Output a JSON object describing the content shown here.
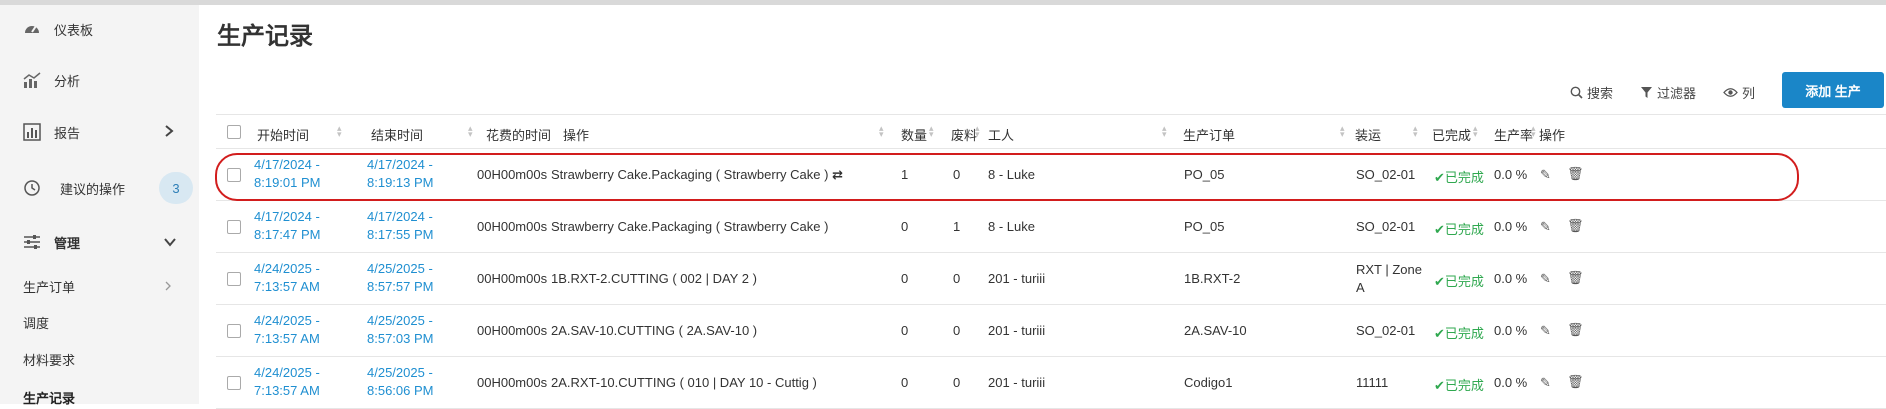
{
  "sidebar": {
    "items": [
      {
        "label": "仪表板",
        "icon": "dashboard-icon"
      },
      {
        "label": "分析",
        "icon": "analytics-icon"
      },
      {
        "label": "报告",
        "icon": "report-icon"
      },
      {
        "label": "建议的操作",
        "icon": "history-icon",
        "badge": "3"
      },
      {
        "label": "管理",
        "icon": "sliders-icon"
      }
    ],
    "sub_items": [
      "生产订单",
      "调度",
      "材料要求",
      "生产记录"
    ]
  },
  "page": {
    "title": "生产记录"
  },
  "toolbar": {
    "search": "搜索",
    "filter": "过滤器",
    "columns": "列",
    "add": "添加 生产"
  },
  "table": {
    "headers": [
      "开始时间",
      "结束时间",
      "花费的时间",
      "操作",
      "数量",
      "废料",
      "工人",
      "生产订单",
      "装运",
      "已完成",
      "生产率",
      "操作"
    ],
    "rows": [
      {
        "start1": "4/17/2024 -",
        "start2": "8:19:01 PM",
        "end1": "4/17/2024 -",
        "end2": "8:19:13 PM",
        "time": "00H00m00s",
        "operation": "Strawberry Cake.Packaging ( Strawberry Cake )",
        "qty": "1",
        "scrap": "0",
        "worker": "8 - Luke",
        "order": "PO_05",
        "ship1": "SO_02-01",
        "ship2": "",
        "done": "已完成",
        "rate": "0.0 %"
      },
      {
        "start1": "4/17/2024 -",
        "start2": "8:17:47 PM",
        "end1": "4/17/2024 -",
        "end2": "8:17:55 PM",
        "time": "00H00m00s",
        "operation": "Strawberry Cake.Packaging ( Strawberry Cake )",
        "qty": "0",
        "scrap": "1",
        "worker": "8 - Luke",
        "order": "PO_05",
        "ship1": "SO_02-01",
        "ship2": "",
        "done": "已完成",
        "rate": "0.0 %"
      },
      {
        "start1": "4/24/2025 -",
        "start2": "7:13:57 AM",
        "end1": "4/25/2025 -",
        "end2": "8:57:57 PM",
        "time": "00H00m00s",
        "operation": "1B.RXT-2.CUTTING ( 002 | DAY 2 )",
        "qty": "0",
        "scrap": "0",
        "worker": "201 - turiii",
        "order": "1B.RXT-2",
        "ship1": "RXT | Zone",
        "ship2": "A",
        "done": "已完成",
        "rate": "0.0 %"
      },
      {
        "start1": "4/24/2025 -",
        "start2": "7:13:57 AM",
        "end1": "4/25/2025 -",
        "end2": "8:57:03 PM",
        "time": "00H00m00s",
        "operation": "2A.SAV-10.CUTTING ( 2A.SAV-10 )",
        "qty": "0",
        "scrap": "0",
        "worker": "201 - turiii",
        "order": "2A.SAV-10",
        "ship1": "SO_02-01",
        "ship2": "",
        "done": "已完成",
        "rate": "0.0 %"
      },
      {
        "start1": "4/24/2025 -",
        "start2": "7:13:57 AM",
        "end1": "4/25/2025 -",
        "end2": "8:56:06 PM",
        "time": "00H00m00s",
        "operation": "2A.RXT-10.CUTTING ( 010 | DAY 10 - Cuttig )",
        "qty": "0",
        "scrap": "0",
        "worker": "201 - turiii",
        "order": "Codigo1",
        "ship1": "11111",
        "ship2": "",
        "done": "已完成",
        "rate": "0.0 %"
      }
    ]
  },
  "colors": {
    "accent": "#1a86c8",
    "link": "#1f8fd1",
    "success": "#2fa84f",
    "highlight": "#d21d1d"
  }
}
